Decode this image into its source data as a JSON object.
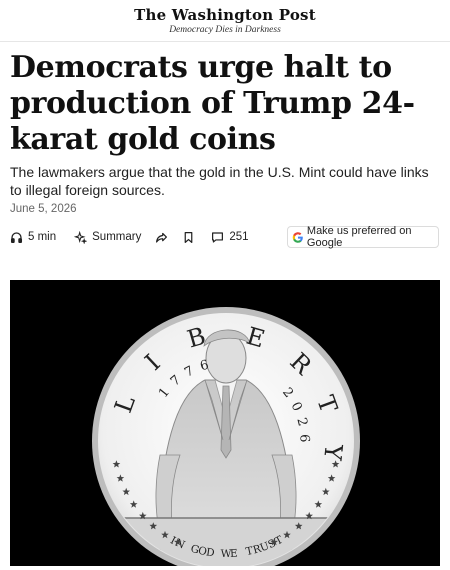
{
  "masthead": {
    "logo": "The Washington Post",
    "tagline": "Democracy Dies in Darkness"
  },
  "article": {
    "headline": "Democrats urge halt to production of Trump 24-karat gold coins",
    "dek": "The lawmakers argue that the gold in the U.S. Mint could have links to illegal foreign sources.",
    "date": "June 5, 2026"
  },
  "toolbar": {
    "listen_label": "5 min",
    "summary_label": "Summary",
    "comments_count": "251",
    "google_label": "Make us preferred on Google",
    "icons": [
      "headphones-icon",
      "sparkle-icon",
      "share-icon",
      "bookmark-icon",
      "comment-icon",
      "google-icon"
    ]
  },
  "coin": {
    "rim_letters": [
      "L",
      "I",
      "B",
      "E",
      "R",
      "T",
      "Y"
    ],
    "year_left": [
      "1",
      "7",
      "7",
      "6"
    ],
    "year_right": [
      "2",
      "0",
      "2",
      "6"
    ],
    "motto": "IN GOD WE TRUST",
    "colors": {
      "background": "#000000",
      "coin": "#eeeeee",
      "rim": "#cfcfcf"
    }
  }
}
